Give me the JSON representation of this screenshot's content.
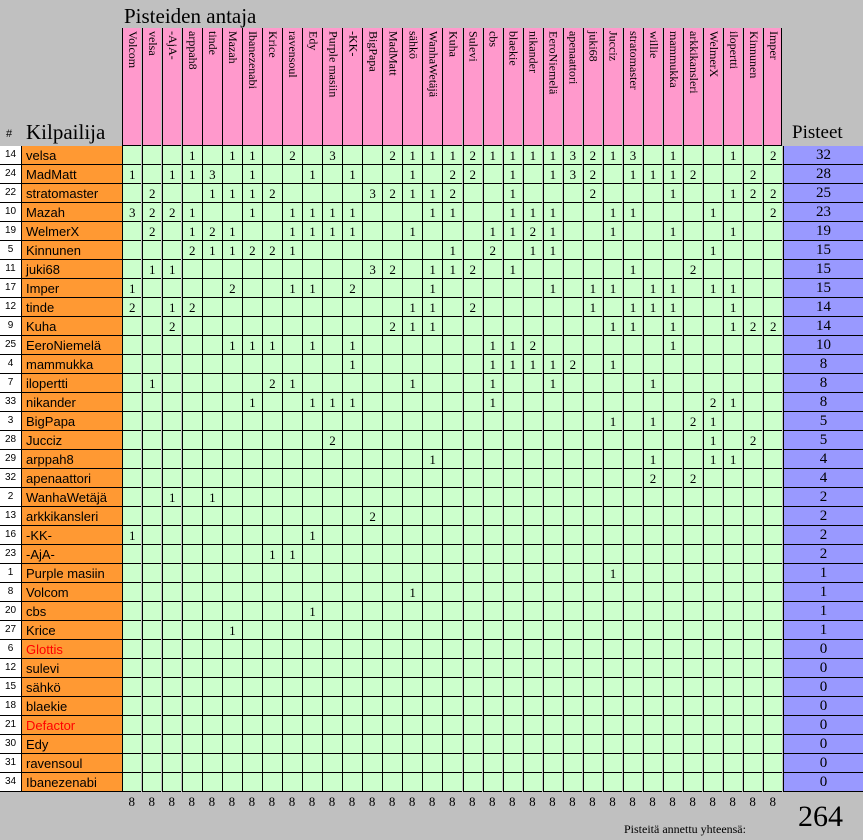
{
  "header": {
    "title": "Pisteiden antaja",
    "hash": "#",
    "competitor_label": "Kilpailija",
    "points_label": "Pisteet"
  },
  "givers": [
    "Volcom",
    "velsa",
    "-AjA-",
    "arppah8",
    "tinde",
    "Mazah",
    "Ibanezenabi",
    "Krice",
    "ravensoul",
    "Edy",
    "Purple masiin",
    "-KK-",
    "BigPapa",
    "MadMatt",
    "sähkö",
    "WanhaWetäjä",
    "Kuha",
    "Sulevi",
    "cbs",
    "blaekie",
    "nikander",
    "EeroNiemelä",
    "apenaattori",
    "juki68",
    "Jucciz",
    "stratomaster",
    "willie",
    "mammukka",
    "arkkikansleri",
    "WelmerX",
    "ilopertti",
    "Kinnunen",
    "Imper"
  ],
  "rows": [
    {
      "num": "14",
      "name": "velsa",
      "red": false,
      "cells": [
        "",
        "",
        "",
        "1",
        "",
        "1",
        "1",
        "",
        "2",
        "",
        "3",
        "",
        "",
        "2",
        "1",
        "1",
        "1",
        "2",
        "1",
        "1",
        "1",
        "1",
        "3",
        "2",
        "1",
        "3",
        "",
        "1",
        "",
        "",
        "1",
        "",
        "2"
      ],
      "total": "32"
    },
    {
      "num": "24",
      "name": "MadMatt",
      "red": false,
      "cells": [
        "1",
        "",
        "1",
        "1",
        "3",
        "",
        "1",
        "",
        "",
        "1",
        "",
        "1",
        "",
        "",
        "1",
        "",
        "2",
        "2",
        "",
        "1",
        "",
        "1",
        "3",
        "2",
        "",
        "1",
        "1",
        "1",
        "2",
        "",
        "",
        "2",
        ""
      ],
      "total": "28"
    },
    {
      "num": "22",
      "name": "stratomaster",
      "red": false,
      "cells": [
        "",
        "2",
        "",
        "",
        "1",
        "1",
        "1",
        "2",
        "",
        "",
        "",
        "",
        "3",
        "2",
        "1",
        "1",
        "2",
        "",
        "",
        "1",
        "",
        "",
        "",
        "2",
        "",
        "",
        "",
        "1",
        "",
        "",
        "1",
        "2",
        "2"
      ],
      "total": "25"
    },
    {
      "num": "10",
      "name": "Mazah",
      "red": false,
      "cells": [
        "3",
        "2",
        "2",
        "1",
        "",
        "",
        "1",
        "",
        "1",
        "1",
        "1",
        "1",
        "",
        "",
        "",
        "1",
        "1",
        "",
        "",
        "1",
        "1",
        "1",
        "",
        "",
        "1",
        "1",
        "",
        "",
        "",
        "1",
        "",
        "",
        "2"
      ],
      "total": "23"
    },
    {
      "num": "19",
      "name": "WelmerX",
      "red": false,
      "cells": [
        "",
        "2",
        "",
        "1",
        "2",
        "1",
        "",
        "",
        "1",
        "1",
        "1",
        "1",
        "",
        "",
        "1",
        "",
        "",
        "",
        "1",
        "1",
        "2",
        "1",
        "",
        "",
        "1",
        "",
        "",
        "1",
        "",
        "",
        "1",
        "",
        ""
      ],
      "total": "19"
    },
    {
      "num": "5",
      "name": "Kinnunen",
      "red": false,
      "cells": [
        "",
        "",
        "",
        "2",
        "1",
        "1",
        "2",
        "2",
        "1",
        "",
        "",
        "",
        "",
        "",
        "",
        "",
        "1",
        "",
        "2",
        "",
        "1",
        "1",
        "",
        "",
        "",
        "",
        "",
        "",
        "",
        "1",
        "",
        "",
        ""
      ],
      "total": "15"
    },
    {
      "num": "11",
      "name": "juki68",
      "red": false,
      "cells": [
        "",
        "1",
        "1",
        "",
        "",
        "",
        "",
        "",
        "",
        "",
        "",
        "",
        "3",
        "2",
        "",
        "1",
        "1",
        "2",
        "",
        "1",
        "",
        "",
        "",
        "",
        "",
        "1",
        "",
        "",
        "2",
        "",
        "",
        "",
        ""
      ],
      "total": "15"
    },
    {
      "num": "17",
      "name": "Imper",
      "red": false,
      "cells": [
        "1",
        "",
        "",
        "",
        "",
        "2",
        "",
        "",
        "1",
        "1",
        "",
        "2",
        "",
        "",
        "",
        "1",
        "",
        "",
        "",
        "",
        "",
        "1",
        "",
        "1",
        "1",
        "",
        "1",
        "1",
        "",
        "1",
        "1",
        "",
        ""
      ],
      "total": "15"
    },
    {
      "num": "12",
      "name": "tinde",
      "red": false,
      "cells": [
        "2",
        "",
        "1",
        "2",
        "",
        "",
        "",
        "",
        "",
        "",
        "",
        "",
        "",
        "",
        "1",
        "1",
        "",
        "2",
        "",
        "",
        "",
        "",
        "",
        "1",
        "",
        "1",
        "1",
        "1",
        "",
        "",
        "1",
        "",
        ""
      ],
      "total": "14"
    },
    {
      "num": "9",
      "name": "Kuha",
      "red": false,
      "cells": [
        "",
        "",
        "2",
        "",
        "",
        "",
        "",
        "",
        "",
        "",
        "",
        "",
        "",
        "2",
        "1",
        "1",
        "",
        "",
        "",
        "",
        "",
        "",
        "",
        "",
        "1",
        "1",
        "",
        "1",
        "",
        "",
        "1",
        "2",
        "2"
      ],
      "total": "14"
    },
    {
      "num": "25",
      "name": "EeroNiemelä",
      "red": false,
      "cells": [
        "",
        "",
        "",
        "",
        "",
        "1",
        "1",
        "1",
        "",
        "1",
        "",
        "1",
        "",
        "",
        "",
        "",
        "",
        "",
        "1",
        "1",
        "2",
        "",
        "",
        "",
        "",
        "",
        "",
        "1",
        "",
        "",
        "",
        "",
        ""
      ],
      "total": "10"
    },
    {
      "num": "4",
      "name": "mammukka",
      "red": false,
      "cells": [
        "",
        "",
        "",
        "",
        "",
        "",
        "",
        "",
        "",
        "",
        "",
        "1",
        "",
        "",
        "",
        "",
        "",
        "",
        "1",
        "1",
        "1",
        "1",
        "2",
        "",
        "1",
        "",
        "",
        "",
        "",
        "",
        "",
        "",
        ""
      ],
      "total": "8"
    },
    {
      "num": "7",
      "name": "ilopertti",
      "red": false,
      "cells": [
        "",
        "1",
        "",
        "",
        "",
        "",
        "",
        "2",
        "1",
        "",
        "",
        "",
        "",
        "",
        "1",
        "",
        "",
        "",
        "1",
        "",
        "",
        "1",
        "",
        "",
        "",
        "",
        "1",
        "",
        "",
        "",
        "",
        "",
        ""
      ],
      "total": "8"
    },
    {
      "num": "33",
      "name": "nikander",
      "red": false,
      "cells": [
        "",
        "",
        "",
        "",
        "",
        "",
        "1",
        "",
        "",
        "1",
        "1",
        "1",
        "",
        "",
        "",
        "",
        "",
        "",
        "1",
        "",
        "",
        "",
        "",
        "",
        "",
        "",
        "",
        "",
        "",
        "2",
        "1",
        "",
        ""
      ],
      "total": "8"
    },
    {
      "num": "3",
      "name": "BigPapa",
      "red": false,
      "cells": [
        "",
        "",
        "",
        "",
        "",
        "",
        "",
        "",
        "",
        "",
        "",
        "",
        "",
        "",
        "",
        "",
        "",
        "",
        "",
        "",
        "",
        "",
        "",
        "",
        "1",
        "",
        "1",
        "",
        "2",
        "1",
        "",
        "",
        ""
      ],
      "total": "5"
    },
    {
      "num": "28",
      "name": "Jucciz",
      "red": false,
      "cells": [
        "",
        "",
        "",
        "",
        "",
        "",
        "",
        "",
        "",
        "",
        "2",
        "",
        "",
        "",
        "",
        "",
        "",
        "",
        "",
        "",
        "",
        "",
        "",
        "",
        "",
        "",
        "",
        "",
        "",
        "1",
        "",
        "2",
        ""
      ],
      "total": "5"
    },
    {
      "num": "29",
      "name": "arppah8",
      "red": false,
      "cells": [
        "",
        "",
        "",
        "",
        "",
        "",
        "",
        "",
        "",
        "",
        "",
        "",
        "",
        "",
        "",
        "1",
        "",
        "",
        "",
        "",
        "",
        "",
        "",
        "",
        "",
        "",
        "1",
        "",
        "",
        "1",
        "1",
        "",
        ""
      ],
      "total": "4"
    },
    {
      "num": "32",
      "name": "apenaattori",
      "red": false,
      "cells": [
        "",
        "",
        "",
        "",
        "",
        "",
        "",
        "",
        "",
        "",
        "",
        "",
        "",
        "",
        "",
        "",
        "",
        "",
        "",
        "",
        "",
        "",
        "",
        "",
        "",
        "",
        "2",
        "",
        "2",
        "",
        "",
        "",
        ""
      ],
      "total": "4"
    },
    {
      "num": "2",
      "name": "WanhaWetäjä",
      "red": false,
      "cells": [
        "",
        "",
        "1",
        "",
        "1",
        "",
        "",
        "",
        "",
        "",
        "",
        "",
        "",
        "",
        "",
        "",
        "",
        "",
        "",
        "",
        "",
        "",
        "",
        "",
        "",
        "",
        "",
        "",
        "",
        "",
        "",
        "",
        ""
      ],
      "total": "2"
    },
    {
      "num": "13",
      "name": "arkkikansleri",
      "red": false,
      "cells": [
        "",
        "",
        "",
        "",
        "",
        "",
        "",
        "",
        "",
        "",
        "",
        "",
        "2",
        "",
        "",
        "",
        "",
        "",
        "",
        "",
        "",
        "",
        "",
        "",
        "",
        "",
        "",
        "",
        "",
        "",
        "",
        "",
        ""
      ],
      "total": "2"
    },
    {
      "num": "16",
      "name": "-KK-",
      "red": false,
      "cells": [
        "1",
        "",
        "",
        "",
        "",
        "",
        "",
        "",
        "",
        "1",
        "",
        "",
        "",
        "",
        "",
        "",
        "",
        "",
        "",
        "",
        "",
        "",
        "",
        "",
        "",
        "",
        "",
        "",
        "",
        "",
        "",
        "",
        ""
      ],
      "total": "2"
    },
    {
      "num": "23",
      "name": "-AjA-",
      "red": false,
      "cells": [
        "",
        "",
        "",
        "",
        "",
        "",
        "",
        "1",
        "1",
        "",
        "",
        "",
        "",
        "",
        "",
        "",
        "",
        "",
        "",
        "",
        "",
        "",
        "",
        "",
        "",
        "",
        "",
        "",
        "",
        "",
        "",
        "",
        ""
      ],
      "total": "2"
    },
    {
      "num": "1",
      "name": "Purple masiin",
      "red": false,
      "cells": [
        "",
        "",
        "",
        "",
        "",
        "",
        "",
        "",
        "",
        "",
        "",
        "",
        "",
        "",
        "",
        "",
        "",
        "",
        "",
        "",
        "",
        "",
        "",
        "",
        "1",
        "",
        "",
        "",
        "",
        "",
        "",
        "",
        ""
      ],
      "total": "1"
    },
    {
      "num": "8",
      "name": "Volcom",
      "red": false,
      "cells": [
        "",
        "",
        "",
        "",
        "",
        "",
        "",
        "",
        "",
        "",
        "",
        "",
        "",
        "",
        "1",
        "",
        "",
        "",
        "",
        "",
        "",
        "",
        "",
        "",
        "",
        "",
        "",
        "",
        "",
        "",
        "",
        "",
        ""
      ],
      "total": "1"
    },
    {
      "num": "20",
      "name": "cbs",
      "red": false,
      "cells": [
        "",
        "",
        "",
        "",
        "",
        "",
        "",
        "",
        "",
        "1",
        "",
        "",
        "",
        "",
        "",
        "",
        "",
        "",
        "",
        "",
        "",
        "",
        "",
        "",
        "",
        "",
        "",
        "",
        "",
        "",
        "",
        "",
        ""
      ],
      "total": "1"
    },
    {
      "num": "27",
      "name": "Krice",
      "red": false,
      "cells": [
        "",
        "",
        "",
        "",
        "",
        "1",
        "",
        "",
        "",
        "",
        "",
        "",
        "",
        "",
        "",
        "",
        "",
        "",
        "",
        "",
        "",
        "",
        "",
        "",
        "",
        "",
        "",
        "",
        "",
        "",
        "",
        "",
        ""
      ],
      "total": "1"
    },
    {
      "num": "6",
      "name": "Glottis",
      "red": true,
      "cells": [
        "",
        "",
        "",
        "",
        "",
        "",
        "",
        "",
        "",
        "",
        "",
        "",
        "",
        "",
        "",
        "",
        "",
        "",
        "",
        "",
        "",
        "",
        "",
        "",
        "",
        "",
        "",
        "",
        "",
        "",
        "",
        "",
        ""
      ],
      "total": "0"
    },
    {
      "num": "12",
      "name": "sulevi",
      "red": false,
      "cells": [
        "",
        "",
        "",
        "",
        "",
        "",
        "",
        "",
        "",
        "",
        "",
        "",
        "",
        "",
        "",
        "",
        "",
        "",
        "",
        "",
        "",
        "",
        "",
        "",
        "",
        "",
        "",
        "",
        "",
        "",
        "",
        "",
        ""
      ],
      "total": "0"
    },
    {
      "num": "15",
      "name": "sähkö",
      "red": false,
      "cells": [
        "",
        "",
        "",
        "",
        "",
        "",
        "",
        "",
        "",
        "",
        "",
        "",
        "",
        "",
        "",
        "",
        "",
        "",
        "",
        "",
        "",
        "",
        "",
        "",
        "",
        "",
        "",
        "",
        "",
        "",
        "",
        "",
        ""
      ],
      "total": "0"
    },
    {
      "num": "18",
      "name": "blaekie",
      "red": false,
      "cells": [
        "",
        "",
        "",
        "",
        "",
        "",
        "",
        "",
        "",
        "",
        "",
        "",
        "",
        "",
        "",
        "",
        "",
        "",
        "",
        "",
        "",
        "",
        "",
        "",
        "",
        "",
        "",
        "",
        "",
        "",
        "",
        "",
        ""
      ],
      "total": "0"
    },
    {
      "num": "21",
      "name": "Defactor",
      "red": true,
      "cells": [
        "",
        "",
        "",
        "",
        "",
        "",
        "",
        "",
        "",
        "",
        "",
        "",
        "",
        "",
        "",
        "",
        "",
        "",
        "",
        "",
        "",
        "",
        "",
        "",
        "",
        "",
        "",
        "",
        "",
        "",
        "",
        "",
        ""
      ],
      "total": "0"
    },
    {
      "num": "30",
      "name": "Edy",
      "red": false,
      "cells": [
        "",
        "",
        "",
        "",
        "",
        "",
        "",
        "",
        "",
        "",
        "",
        "",
        "",
        "",
        "",
        "",
        "",
        "",
        "",
        "",
        "",
        "",
        "",
        "",
        "",
        "",
        "",
        "",
        "",
        "",
        "",
        "",
        ""
      ],
      "total": "0"
    },
    {
      "num": "31",
      "name": "ravensoul",
      "red": false,
      "cells": [
        "",
        "",
        "",
        "",
        "",
        "",
        "",
        "",
        "",
        "",
        "",
        "",
        "",
        "",
        "",
        "",
        "",
        "",
        "",
        "",
        "",
        "",
        "",
        "",
        "",
        "",
        "",
        "",
        "",
        "",
        "",
        "",
        ""
      ],
      "total": "0"
    },
    {
      "num": "34",
      "name": "Ibanezenabi",
      "red": false,
      "cells": [
        "",
        "",
        "",
        "",
        "",
        "",
        "",
        "",
        "",
        "",
        "",
        "",
        "",
        "",
        "",
        "",
        "",
        "",
        "",
        "",
        "",
        "",
        "",
        "",
        "",
        "",
        "",
        "",
        "",
        "",
        "",
        "",
        ""
      ],
      "total": "0"
    }
  ],
  "footer": {
    "given_values": [
      "8",
      "8",
      "8",
      "8",
      "8",
      "8",
      "8",
      "8",
      "8",
      "8",
      "8",
      "8",
      "8",
      "8",
      "8",
      "8",
      "8",
      "8",
      "8",
      "8",
      "8",
      "8",
      "8",
      "8",
      "8",
      "8",
      "8",
      "8",
      "8",
      "8",
      "8",
      "8",
      "8"
    ],
    "total_label": "Pisteitä annettu yhteensä:",
    "grand_total": "264"
  },
  "colors": {
    "header_pink": "#ff99cc",
    "name_orange": "#ff9933",
    "cell_green": "#ccffcc",
    "total_blue": "#9999ff",
    "background": "#c0c0c0",
    "red_name": "#ff0000"
  }
}
